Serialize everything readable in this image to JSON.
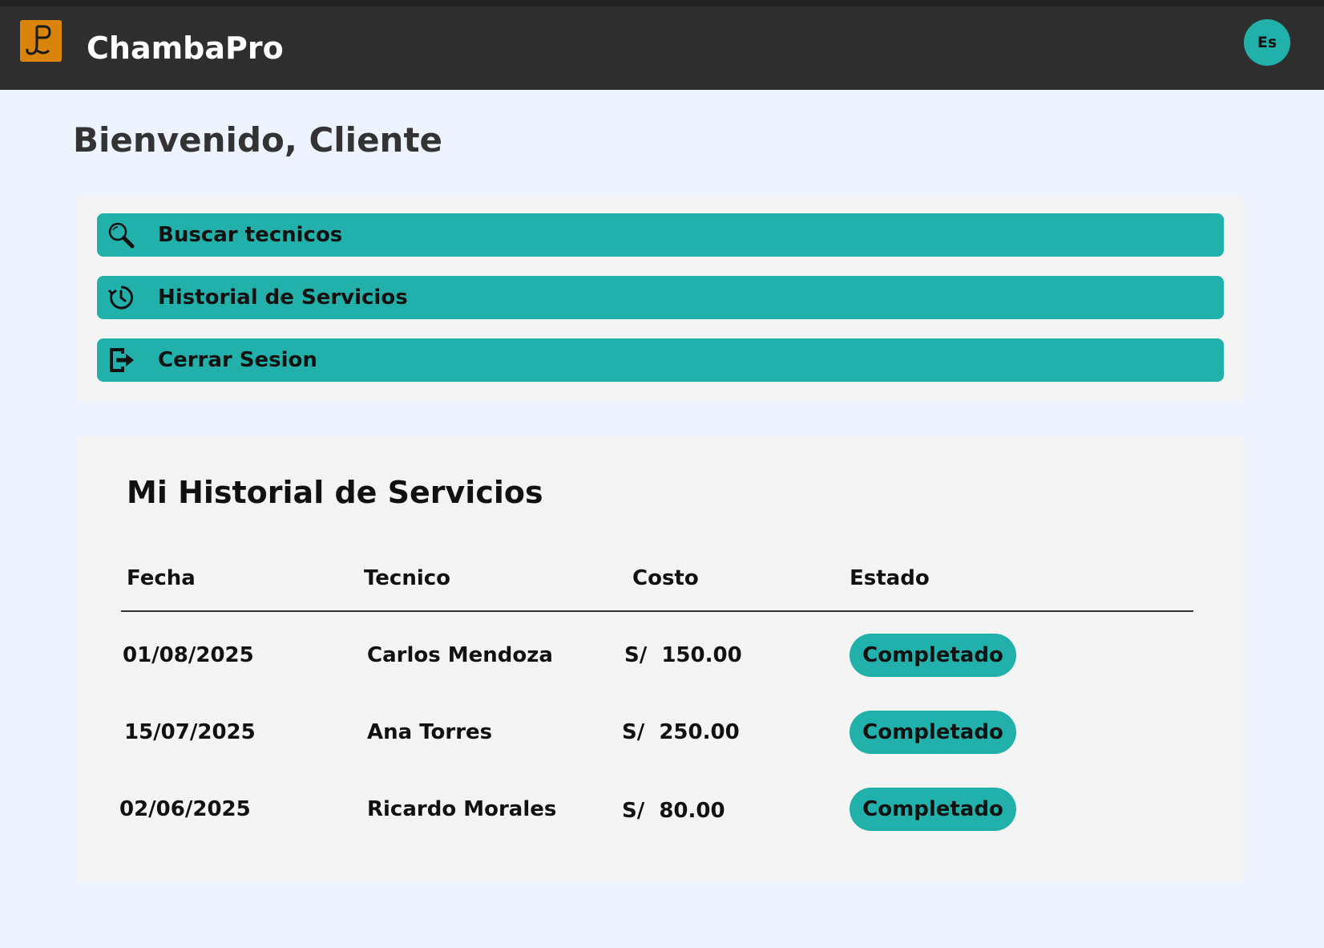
{
  "header": {
    "app_title": "ChambaPro",
    "logo_letter": "P",
    "language_button": "Es"
  },
  "welcome": "Bienvenido, Cliente",
  "menu": {
    "items": [
      {
        "label": "Buscar tecnicos",
        "icon": "search-icon"
      },
      {
        "label": "Historial de Servicios",
        "icon": "history-icon"
      },
      {
        "label": "Cerrar Sesion",
        "icon": "logout-icon"
      }
    ]
  },
  "history": {
    "title": "Mi Historial de Servicios",
    "columns": [
      "Fecha",
      "Tecnico",
      "Costo",
      "Estado"
    ],
    "rows": [
      {
        "fecha": "01/08/2025",
        "tecnico": "Carlos Mendoza",
        "costo": "S/  150.00",
        "estado": "Completado"
      },
      {
        "fecha": "15/07/2025",
        "tecnico": "Ana Torres",
        "costo": "S/  250.00",
        "estado": "Completado"
      },
      {
        "fecha": "02/06/2025",
        "tecnico": "Ricardo Morales",
        "costo": "S/  80.00",
        "estado": "Completado"
      }
    ]
  },
  "colors": {
    "header_bg": "#2e2e2e",
    "accent": "#22b1aa",
    "logo_bg": "#d9830b",
    "page_bg": "#eef4ff",
    "card_bg": "#f4f4f4"
  }
}
